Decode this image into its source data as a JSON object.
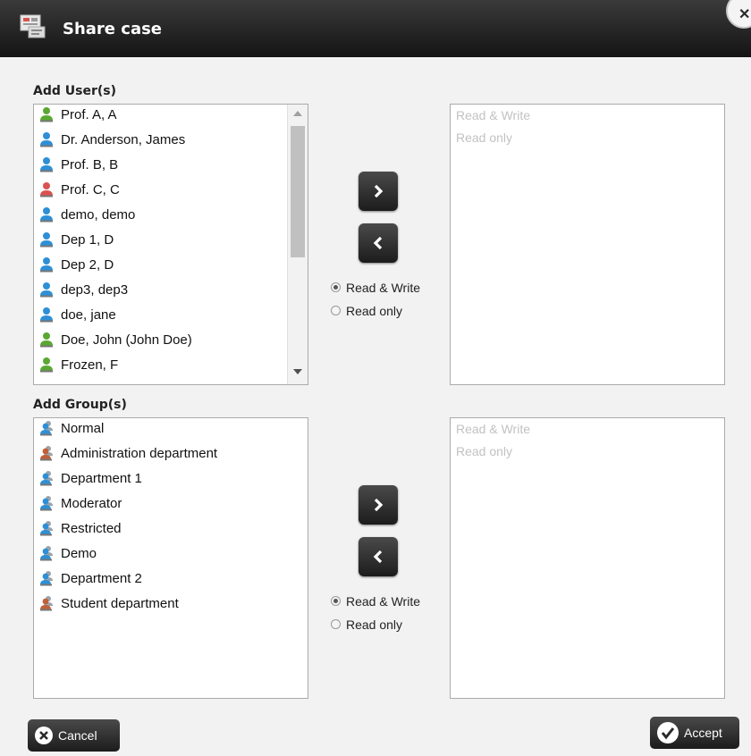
{
  "dialog": {
    "title": "Share case"
  },
  "users": {
    "label": "Add User(s)",
    "items": [
      {
        "label": "Prof. A, A",
        "color": "#5aa832"
      },
      {
        "label": "Dr. Anderson, James",
        "color": "#2e8fd6"
      },
      {
        "label": "Prof. B, B",
        "color": "#2e8fd6"
      },
      {
        "label": "Prof. C, C",
        "color": "#d9534f"
      },
      {
        "label": "demo, demo",
        "color": "#2e8fd6"
      },
      {
        "label": "Dep 1, D",
        "color": "#2e8fd6"
      },
      {
        "label": "Dep 2, D",
        "color": "#2e8fd6"
      },
      {
        "label": "dep3, dep3",
        "color": "#2e8fd6"
      },
      {
        "label": "doe, jane",
        "color": "#2e8fd6"
      },
      {
        "label": "Doe, John (John Doe)",
        "color": "#5aa832"
      },
      {
        "label": "Frozen, F",
        "color": "#5aa832"
      }
    ],
    "radio": {
      "read_write": "Read & Write",
      "read_only": "Read only",
      "selected": "read_write"
    },
    "target": {
      "read_write": "Read & Write",
      "read_only": "Read only"
    }
  },
  "groups": {
    "label": "Add Group(s)",
    "items": [
      {
        "label": "Normal",
        "color": "#2e8fd6"
      },
      {
        "label": "Administration department",
        "color": "#c0603a"
      },
      {
        "label": "Department 1",
        "color": "#2e8fd6"
      },
      {
        "label": "Moderator",
        "color": "#2e8fd6"
      },
      {
        "label": "Restricted",
        "color": "#2e8fd6"
      },
      {
        "label": "Demo",
        "color": "#2e8fd6"
      },
      {
        "label": "Department 2",
        "color": "#2e8fd6"
      },
      {
        "label": "Student department",
        "color": "#c0603a"
      }
    ],
    "radio": {
      "read_write": "Read & Write",
      "read_only": "Read only",
      "selected": "read_write"
    },
    "target": {
      "read_write": "Read & Write",
      "read_only": "Read only"
    }
  },
  "footer": {
    "cancel": "Cancel",
    "accept": "Accept"
  },
  "icons": {
    "title": "share-case-icon",
    "close": "close-icon",
    "add": "chevron-right-icon",
    "remove": "chevron-left-icon",
    "user": "user-icon",
    "group": "group-icon",
    "cancel": "cancel-icon",
    "accept": "checkmark-icon"
  }
}
